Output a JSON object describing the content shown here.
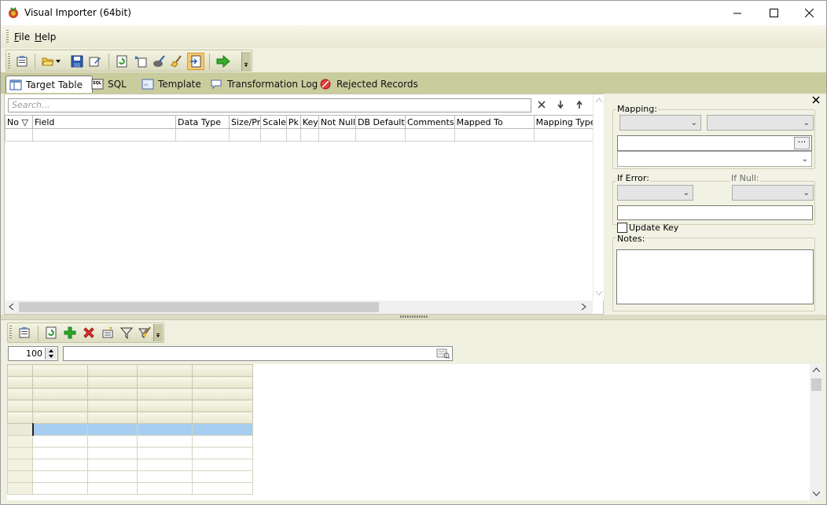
{
  "window": {
    "title": "Visual Importer (64bit)"
  },
  "menu": {
    "items": [
      "File",
      "Help"
    ]
  },
  "tabs": [
    {
      "label": "Target Table",
      "active": true
    },
    {
      "label": "SQL",
      "active": false
    },
    {
      "label": "Template",
      "active": false
    },
    {
      "label": "Transformation Log",
      "active": false
    },
    {
      "label": "Rejected Records",
      "active": false
    }
  ],
  "target": {
    "search_placeholder": "Search...",
    "columns": [
      "No ▽",
      "Field",
      "Data Type",
      "Size/Pr",
      "Scale",
      "Pk",
      "Key",
      "Not Null",
      "DB Default",
      "Comments",
      "Mapped To",
      "Mapping Type"
    ]
  },
  "mapping_panel": {
    "mapping_label": "Mapping:",
    "if_error_label": "If Error:",
    "if_null_label": "If Null:",
    "update_key_label": "Update Key",
    "update_key_checked": false,
    "notes_label": "Notes:",
    "browse_label": "···"
  },
  "bottom": {
    "row_limit": "100"
  },
  "colors": {
    "tab_band": "#c9cc9d",
    "selection": "#a7cef0"
  }
}
